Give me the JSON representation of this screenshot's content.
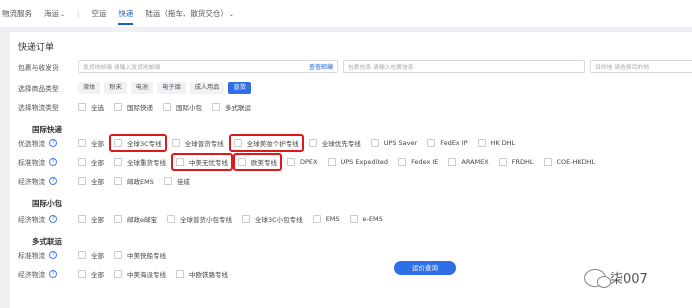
{
  "nav": {
    "items": [
      {
        "label": "物流服务",
        "chevron": false,
        "active": false
      },
      {
        "label": "海运",
        "chevron": true,
        "active": false
      },
      {
        "label": "空运",
        "chevron": false,
        "active": false
      },
      {
        "label": "快递",
        "chevron": false,
        "active": true
      },
      {
        "label": "陆运（拖车、散货交仓）",
        "chevron": true,
        "active": false
      }
    ]
  },
  "form": {
    "title": "快递订单",
    "addr_label": "包裹与收发货",
    "addr_placeholder": "发货地邮编  请输入发货地邮编",
    "addr_link": "查查邮编",
    "pkg_placeholder": "包裹信息  请输入包裹信息",
    "dest_placeholder": "目的地  请选择目的地",
    "goods_label": "选择商品类型",
    "goods": [
      "液体",
      "粉末",
      "电池",
      "电子烟",
      "成人用品",
      "普货"
    ],
    "logistics_label": "选择物流类型",
    "logistics": [
      "全选",
      "国际快递",
      "国际小包",
      "多式联运"
    ],
    "section_express": "国际快递",
    "preferred_label": "优选物流",
    "preferred": [
      "全部",
      "全球3C专线",
      "全球普货专线",
      "全球美妆个护专线",
      "全球优先专线",
      "UPS Saver",
      "FedEx IP",
      "HK DHL"
    ],
    "standard_label": "标准物流",
    "standard": [
      "全部",
      "全球重货专线",
      "中美无忧专线",
      "欧美专线",
      "DPEX",
      "UPS Expedited",
      "Fedex IE",
      "ARAMEX",
      "FRDHL",
      "COE-HKDHL"
    ],
    "economy_label": "经济物流",
    "economy": [
      "全部",
      "邮政EMS",
      "佳成"
    ],
    "section_small": "国际小包",
    "small_label": "经济物流",
    "small": [
      "全部",
      "邮政e邮宝",
      "全球普货小包专线",
      "全球3C小包专线",
      "EMS",
      "e-EMS"
    ],
    "section_multi": "多式联运",
    "multi_std_label": "标准物流",
    "multi_std": [
      "全部",
      "中美快船专线"
    ],
    "multi_eco_label": "经济物流",
    "multi_eco": [
      "全部",
      "中美海派专线",
      "中欧铁路专线"
    ],
    "submit": "运价查询",
    "watermark": "柒007",
    "help": "?"
  },
  "colors": {
    "accent": "#2f6ee6",
    "highlight": "#e0181c"
  }
}
